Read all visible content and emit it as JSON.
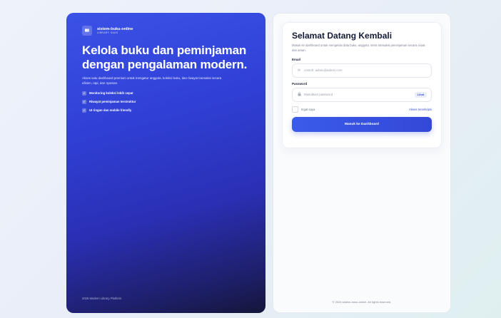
{
  "hero": {
    "brand_name": "sistem-buku-online",
    "brand_sub": "LIBRARY SAAS",
    "headline": "Kelola buku dan peminjaman dengan pengalaman modern.",
    "description": "Akses satu dashboard premium untuk mengatur anggota, koleksi buku, dan riwayat transaksi secara efisien, rapi, dan nyaman.",
    "features": [
      "Monitoring koleksi lebih cepat",
      "Riwayat peminjaman terstruktur",
      "UI ringan dan mobile friendly"
    ],
    "footer": "2026 Modern Library Platform"
  },
  "login": {
    "title": "Selamat Datang Kembali",
    "description": "Masuk ke dashboard untuk mengelola data buku, anggota, serta transaksi peminjaman secara cepat dan aman.",
    "email_label": "Email",
    "email_placeholder": "contoh: admin@admin.com",
    "password_label": "Password",
    "password_placeholder": "Masukkan password",
    "show_password": "Lihat",
    "remember": "Ingat saya",
    "forgot": "Akses terenkripsi",
    "submit": "Masuk ke Dashboard"
  },
  "footer": {
    "copyright": "© 2026 sistem-buku-online. All rights reserved."
  },
  "colors": {
    "accent": "#3448d8",
    "hero_start": "#3b52e6",
    "hero_end": "#15163a"
  },
  "icons": {
    "brand": "book-icon",
    "email": "mail-icon",
    "password": "lock-icon",
    "feature": "check-icon"
  }
}
